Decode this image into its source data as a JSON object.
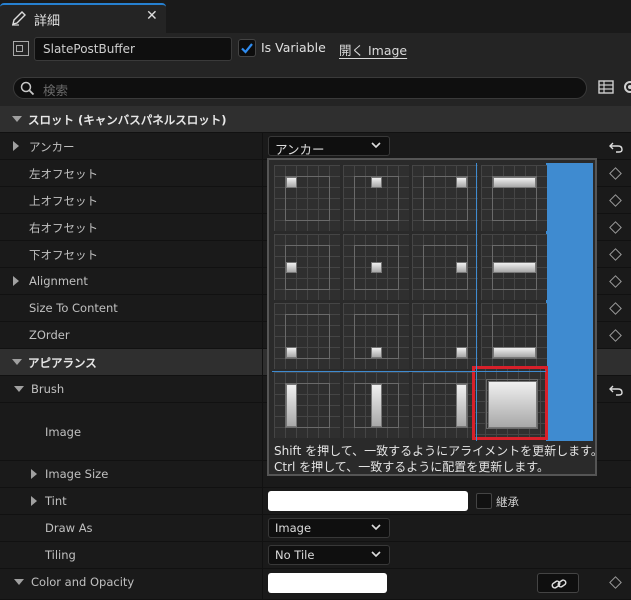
{
  "tab": {
    "title": "詳細"
  },
  "header": {
    "widget_name": "SlatePostBuffer",
    "is_variable_label": "Is Variable",
    "is_variable_checked": true,
    "open_image_label": "開く Image"
  },
  "search": {
    "placeholder": "検索"
  },
  "sections": {
    "slot": "スロット (キャンバスパネルスロット)",
    "appearance": "アピアランス"
  },
  "properties": {
    "anchor": "アンカー",
    "offset_left": "左オフセット",
    "offset_top": "上オフセット",
    "offset_right": "右オフセット",
    "offset_bottom": "下オフセット",
    "alignment": "Alignment",
    "size_to_content": "Size To Content",
    "zorder": "ZOrder",
    "brush": "Brush",
    "image": "Image",
    "image_size": "Image Size",
    "tint": "Tint",
    "draw_as": "Draw As",
    "tiling": "Tiling",
    "color_and_opacity": "Color and Opacity"
  },
  "values": {
    "anchor_combo": "アンカー",
    "inherit_label": "継承",
    "draw_as": "Image",
    "tiling": "No Tile"
  },
  "anchor_popup": {
    "hint_shift": "Shift を押して、一致するようにアライメントを更新します。",
    "hint_ctrl": "Ctrl を押して、一致するように配置を更新します。",
    "selected_preset": "stretch-both"
  },
  "colors": {
    "accent_blue": "#3f8bd0",
    "selection_red": "#d8202a",
    "panel_bg": "#1a1a1a"
  }
}
